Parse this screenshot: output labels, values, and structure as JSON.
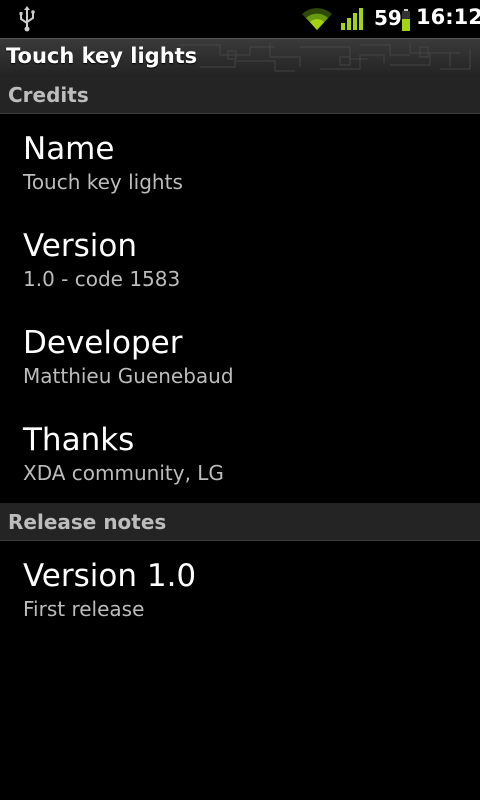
{
  "status_bar": {
    "battery_percent": "59",
    "time": "16:12",
    "icons": [
      "usb-icon",
      "wifi-icon",
      "signal-icon",
      "battery-icon"
    ],
    "accent_color": "#a4d311"
  },
  "app_title": "Touch key lights",
  "sections": {
    "credits": {
      "header": "Credits",
      "items": [
        {
          "label": "Name",
          "value": "Touch key lights"
        },
        {
          "label": "Version",
          "value": "1.0 - code 1583"
        },
        {
          "label": "Developer",
          "value": "Matthieu Guenebaud"
        },
        {
          "label": "Thanks",
          "value": "XDA community, LG"
        }
      ]
    },
    "release_notes": {
      "header": "Release notes",
      "items": [
        {
          "label": "Version 1.0",
          "value": "First release"
        }
      ]
    }
  }
}
